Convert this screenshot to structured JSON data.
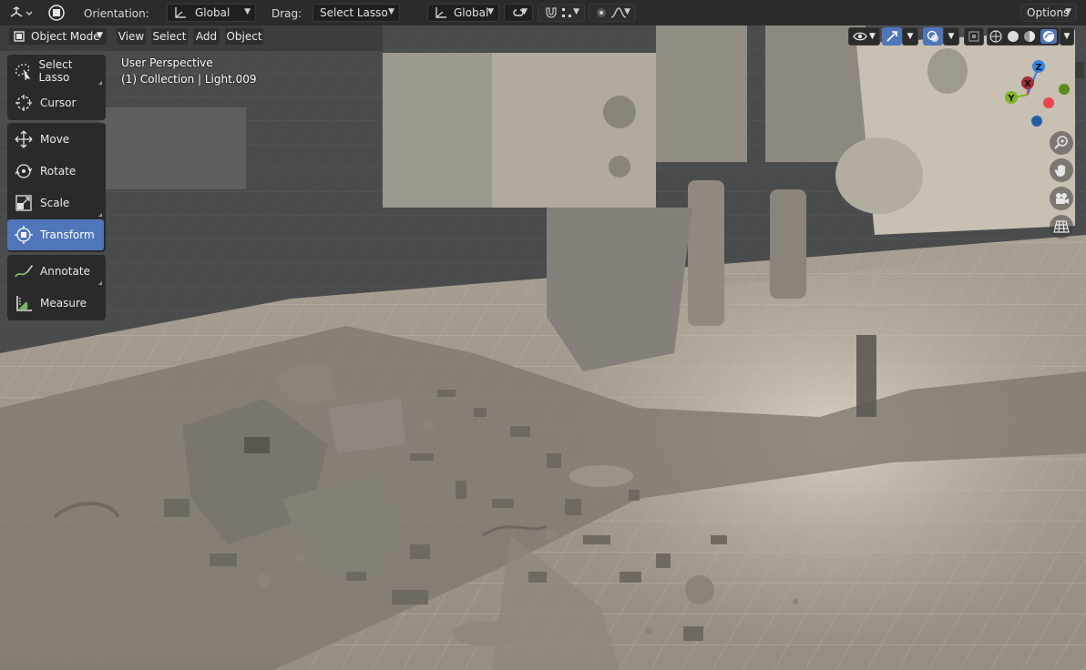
{
  "topbar": {
    "orientation_label": "Orientation:",
    "orientation_value": "Global",
    "drag_label": "Drag:",
    "drag_value": "Select Lasso",
    "transform_pivot_value": "Global",
    "options_label": "Options"
  },
  "header": {
    "mode_value": "Object Mode",
    "menu": [
      "View",
      "Select",
      "Add",
      "Object"
    ]
  },
  "toolbar": {
    "groups": [
      [
        "Select Lasso",
        "Cursor"
      ],
      [
        "Move",
        "Rotate",
        "Scale",
        "Transform"
      ],
      [
        "Annotate",
        "Measure"
      ]
    ],
    "active_tool": "Transform"
  },
  "viewport": {
    "perspective": "User Perspective",
    "collection": "(1) Collection | Light.009"
  },
  "gizmo": {
    "axis_z": "Z",
    "axis_y": "Y",
    "axis_x": "X",
    "color_x": "#e8454f",
    "color_y": "#7fb526",
    "color_z": "#2f86e1"
  },
  "colors": {
    "accent": "#4f76b8",
    "header_bg": "#2b2b2b",
    "floor": "#bfb6a6",
    "grid_dark": "#3e4044"
  },
  "icons": {
    "editor_type": "3d-viewport-icon",
    "mode": "object-mode-icon",
    "viewport_visibility": "eye-icon",
    "gizmo_toggle": "gizmo-icon",
    "overlay_toggle": "overlay-icon",
    "xray": "xray-icon",
    "shading": [
      "wireframe-icon",
      "solid-icon",
      "material-preview-icon",
      "rendered-icon"
    ],
    "nav": [
      "zoom-icon",
      "hand-pan-icon",
      "camera-icon",
      "grid-ortho-icon"
    ]
  }
}
